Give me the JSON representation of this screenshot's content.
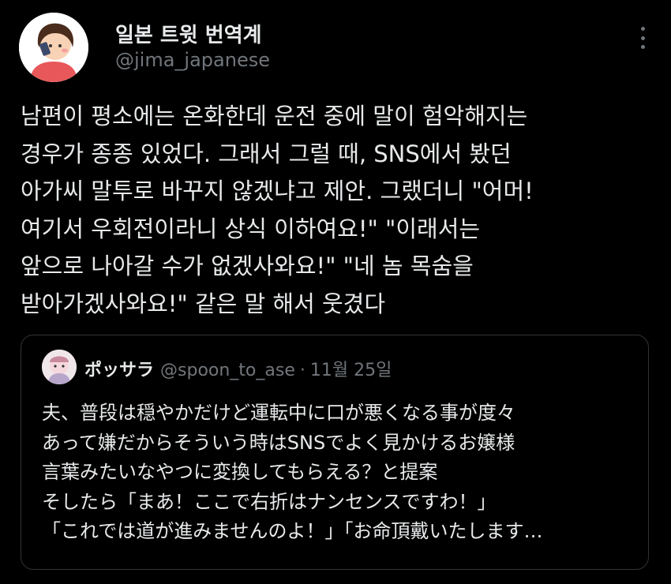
{
  "tweet": {
    "display_name": "일본 트윗 번역계",
    "handle": "@jima_japanese",
    "body_lines": [
      "남편이 평소에는 온화한데 운전 중에 말이 험악해지는",
      "경우가 종종 있었다. 그래서 그럴 때, SNS에서 봤던",
      "아가씨 말투로 바꾸지 않겠냐고 제안. 그랬더니 \"어머!",
      "여기서 우회전이라니 상식 이하여요!\" \"이래서는",
      "앞으로 나아갈 수가 없겠사와요!\" \"네 놈 목숨을",
      "받아가겠사와요!\" 같은 말 해서 웃겼다"
    ]
  },
  "quoted": {
    "display_name": "ポッサラ",
    "handle": "@spoon_to_ase",
    "separator": "·",
    "date": "11월 25일",
    "text_lines": [
      "夫、普段は穏やかだけど運転中に口が悪くなる事が度々",
      "あって嫌だからそういう時はSNSでよく見かけるお嬢様",
      "言葉みたいなやつに変換してもらえる？と提案",
      "そしたら「まあ！ここで右折はナンセンスですわ！」",
      "「これでは道が進みませんのよ！」「お命頂戴いたします…"
    ]
  },
  "icons": {
    "more": "more-options-icon"
  }
}
